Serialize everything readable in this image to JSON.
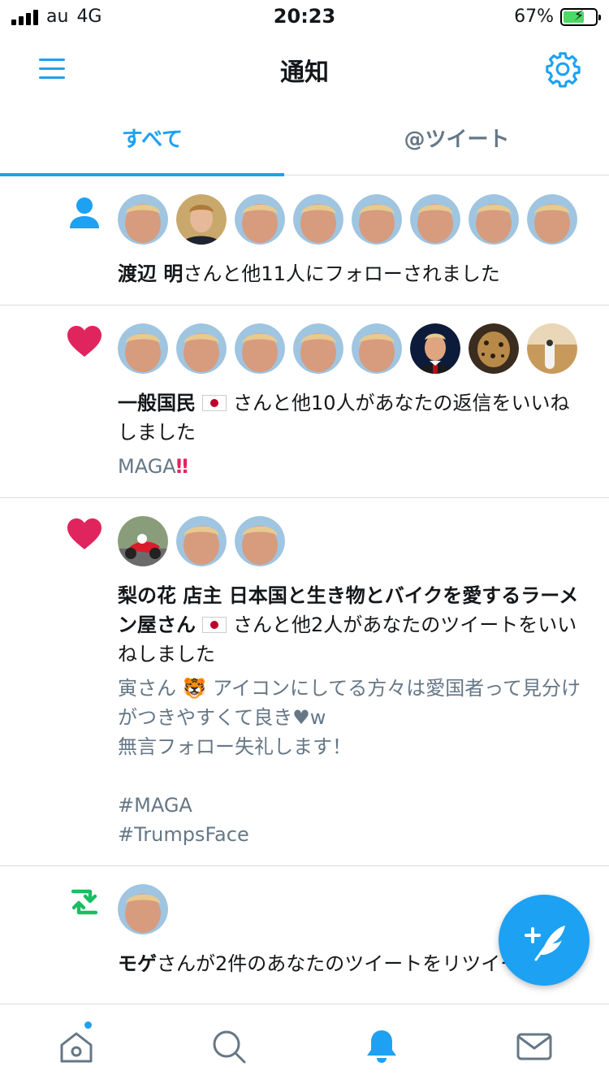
{
  "status_bar": {
    "carrier": "au",
    "network": "4G",
    "time": "20:23",
    "battery": "67%",
    "battery_level": 0.67
  },
  "header": {
    "title": "通知"
  },
  "tabs": [
    {
      "label": "すべて",
      "active": true
    },
    {
      "label": "@ツイート",
      "active": false
    }
  ],
  "notifications": [
    {
      "type": "follow",
      "icon": "person-icon",
      "name": "渡辺 明",
      "text": "さんと他11人にフォローされました",
      "sub": ""
    },
    {
      "type": "like",
      "icon": "heart-icon",
      "name": "一般国民",
      "text": "さんと他10人があなたの返信をいいねしました",
      "sub_pre": "MAGA",
      "sub_emoji": "‼"
    },
    {
      "type": "like",
      "icon": "heart-icon",
      "name": "梨の花 店主 日本国と生き物とバイクを愛するラーメン屋さん",
      "text": "さんと他2人があなたのツイートをいいねしました",
      "sub_pre": "寅さん",
      "sub_emoji": "🐯",
      "sub_rest": "アイコンにしてる方々は愛国者って見分けがつきやすくて良き",
      "sub_heart": "♥",
      "sub_w": "w",
      "sub_body": "\n無言フォロー失礼します！\n\n#MAGA\n#TrumpsFace"
    },
    {
      "type": "retweet",
      "icon": "retweet-icon",
      "name": "モゲ",
      "text": "さんが2件のあなたのツイートをリツイート"
    }
  ],
  "colors": {
    "accent": "#1da1f2",
    "like": "#e0245e",
    "retweet": "#17bf63",
    "muted": "#657786",
    "divider": "#d8dde1"
  }
}
